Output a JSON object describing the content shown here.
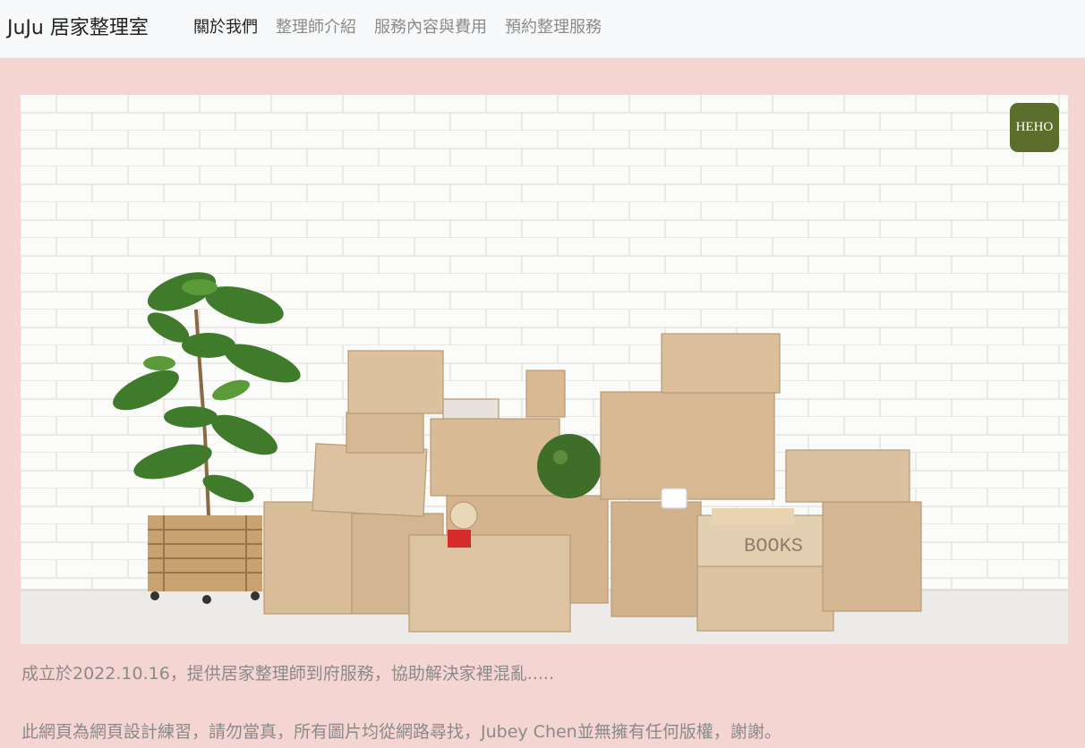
{
  "navbar": {
    "brand": "JuJu 居家整理室",
    "links": [
      {
        "label": "關於我們",
        "active": true
      },
      {
        "label": "整理師介紹",
        "active": false
      },
      {
        "label": "服務內容與費用",
        "active": false
      },
      {
        "label": "預約整理服務",
        "active": false
      }
    ]
  },
  "hero": {
    "box_label": "BOOKS",
    "badge_text": "HEHO"
  },
  "content": {
    "intro": "成立於2022.10.16，提供居家整理師到府服務，協助解決家裡混亂.....",
    "disclaimer": "此網頁為網頁設計練習，請勿當真，所有圖片均從網路尋找，Jubey Chen並無擁有任何版權，謝謝。"
  },
  "colors": {
    "page_bg": "#f5d5d1",
    "navbar_bg": "#f8f9fa",
    "badge_bg": "#5b6e2b",
    "text_muted": "#8a8a8a"
  }
}
